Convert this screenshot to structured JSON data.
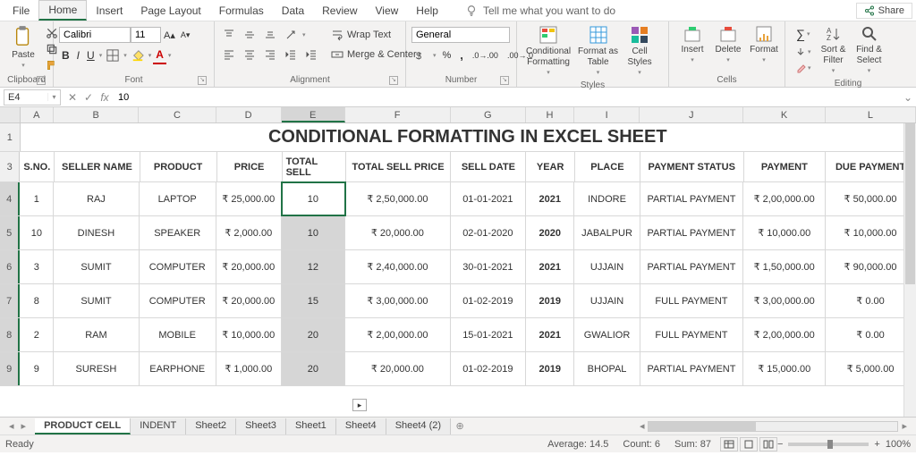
{
  "menu": {
    "file": "File",
    "home": "Home",
    "insert": "Insert",
    "page_layout": "Page Layout",
    "formulas": "Formulas",
    "data": "Data",
    "review": "Review",
    "view": "View",
    "help": "Help",
    "tell_me": "Tell me what you want to do",
    "share": "Share"
  },
  "ribbon": {
    "clipboard": {
      "label": "Clipboard",
      "paste": "Paste"
    },
    "font": {
      "label": "Font",
      "name": "Calibri",
      "size": "11"
    },
    "alignment": {
      "label": "Alignment",
      "wrap": "Wrap Text",
      "merge": "Merge & Center"
    },
    "number": {
      "label": "Number",
      "format": "General"
    },
    "styles": {
      "label": "Styles",
      "cond": "Conditional\nFormatting",
      "table": "Format as\nTable",
      "cell": "Cell\nStyles"
    },
    "cells": {
      "label": "Cells",
      "insert": "Insert",
      "delete": "Delete",
      "format": "Format"
    },
    "editing": {
      "label": "Editing",
      "sort": "Sort &\nFilter",
      "find": "Find &\nSelect"
    }
  },
  "namebox": "E4",
  "formula": "10",
  "cols": [
    "A",
    "B",
    "C",
    "D",
    "E",
    "F",
    "G",
    "H",
    "I",
    "J",
    "K",
    "L"
  ],
  "title": "CONDITIONAL FORMATTING IN EXCEL SHEET",
  "headers": {
    "sno": "S.NO.",
    "seller": "SELLER NAME",
    "product": "PRODUCT",
    "price": "PRICE",
    "total_sell": "TOTAL SELL",
    "total_sell_price": "TOTAL SELL PRICE",
    "sell_date": "SELL DATE",
    "year": "YEAR",
    "place": "PLACE",
    "pay_status": "PAYMENT STATUS",
    "payment": "PAYMENT",
    "due": "DUE PAYMENT"
  },
  "rows": [
    {
      "n": "4",
      "sno": "1",
      "seller": "RAJ",
      "product": "LAPTOP",
      "price": "₹ 25,000.00",
      "ts": "10",
      "tsp": "₹ 2,50,000.00",
      "date": "01-01-2021",
      "year": "2021",
      "place": "INDORE",
      "ps": "PARTIAL PAYMENT",
      "pay": "₹ 2,00,000.00",
      "due": "₹ 50,000.00"
    },
    {
      "n": "5",
      "sno": "10",
      "seller": "DINESH",
      "product": "SPEAKER",
      "price": "₹ 2,000.00",
      "ts": "10",
      "tsp": "₹ 20,000.00",
      "date": "02-01-2020",
      "year": "2020",
      "place": "JABALPUR",
      "ps": "PARTIAL PAYMENT",
      "pay": "₹ 10,000.00",
      "due": "₹ 10,000.00"
    },
    {
      "n": "6",
      "sno": "3",
      "seller": "SUMIT",
      "product": "COMPUTER",
      "price": "₹ 20,000.00",
      "ts": "12",
      "tsp": "₹ 2,40,000.00",
      "date": "30-01-2021",
      "year": "2021",
      "place": "UJJAIN",
      "ps": "PARTIAL PAYMENT",
      "pay": "₹ 1,50,000.00",
      "due": "₹ 90,000.00"
    },
    {
      "n": "7",
      "sno": "8",
      "seller": "SUMIT",
      "product": "COMPUTER",
      "price": "₹ 20,000.00",
      "ts": "15",
      "tsp": "₹ 3,00,000.00",
      "date": "01-02-2019",
      "year": "2019",
      "place": "UJJAIN",
      "ps": "FULL PAYMENT",
      "pay": "₹ 3,00,000.00",
      "due": "₹ 0.00"
    },
    {
      "n": "8",
      "sno": "2",
      "seller": "RAM",
      "product": "MOBILE",
      "price": "₹ 10,000.00",
      "ts": "20",
      "tsp": "₹ 2,00,000.00",
      "date": "15-01-2021",
      "year": "2021",
      "place": "GWALIOR",
      "ps": "FULL PAYMENT",
      "pay": "₹ 2,00,000.00",
      "due": "₹ 0.00"
    },
    {
      "n": "9",
      "sno": "9",
      "seller": "SURESH",
      "product": "EARPHONE",
      "price": "₹ 1,000.00",
      "ts": "20",
      "tsp": "₹ 20,000.00",
      "date": "01-02-2019",
      "year": "2019",
      "place": "BHOPAL",
      "ps": "PARTIAL PAYMENT",
      "pay": "₹ 15,000.00",
      "due": "₹ 5,000.00"
    }
  ],
  "tabs": [
    "PRODUCT CELL",
    "INDENT",
    "Sheet2",
    "Sheet3",
    "Sheet1",
    "Sheet4",
    "Sheet4 (2)"
  ],
  "status": {
    "ready": "Ready",
    "avg": "Average: 14.5",
    "count": "Count: 6",
    "sum": "Sum: 87",
    "zoom": "100%"
  }
}
